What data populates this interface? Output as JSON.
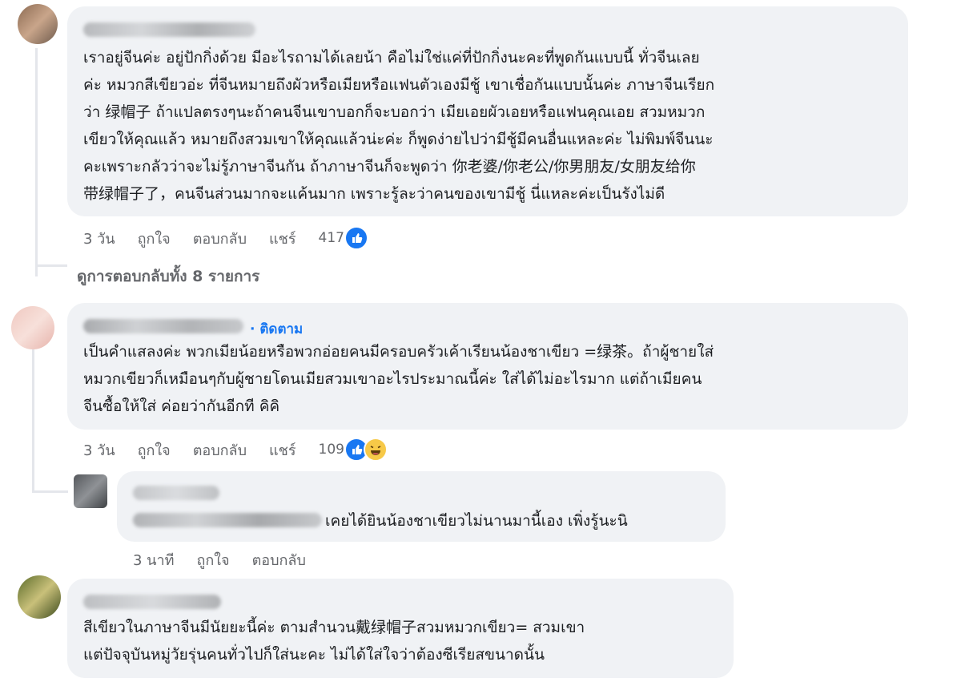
{
  "comments": [
    {
      "text": "เราอยู่จีนค่ะ อยู่ปักกิ่งด้วย มีอะไรถามได้เลยน้า คือไม่ใช่แค่ที่ปักกิ่งนะคะที่พูดกันแบบนี้ ทั่วจีนเลย\nค่ะ หมวกสีเขียวอ่ะ ที่จีนหมายถึงผัวหรือเมียหรือแฟนตัวเองมีชู้ เขาเชื่อกันแบบนั้นค่ะ ภาษาจีนเรียก\nว่า 绿帽子 ถ้าแปลตรงๆนะถ้าคนจีนเขาบอกก็จะบอกว่า เมียเอยผัวเอยหรือแฟนคุณเอย สวมหมวก\nเขียวให้คุณแล้ว หมายถึงสวมเขาให้คุณแล้วน่ะค่ะ ก็พูดง่ายไปว่ามีชู้มีคนอื่นแหละค่ะ ไม่พิมพ์จีนนะ\nคะเพราะกลัวว่าจะไม่รู้ภาษาจีนกัน ถ้าภาษาจีนก็จะพูดว่า 你老婆/你老公/你男朋友/女朋友给你\n带绿帽子了，คนจีนส่วนมากจะแค้นมาก เพราะรู้ละว่าคนของเขามีชู้ นี่แหละค่ะเป็นรังไม่ดี",
      "time": "3 วัน",
      "like": "ถูกใจ",
      "reply": "ตอบกลับ",
      "share": "แชร์",
      "reactions": "417",
      "view_replies": "ดูการตอบกลับทั้ง 8 รายการ"
    },
    {
      "follow": "· ติดตาม",
      "text": "เป็นคำแสลงค่ะ พวกเมียน้อยหรือพวกอ่อยคนมีครอบครัวเค้าเรียนน้องชาเขียว =绿茶。ถ้าผู้ชายใส่\nหมวกเขียวก็เหมือนๆกับผู้ชายโดนเมียสวมเขาอะไรประมาณนี้ค่ะ ใส่ได้ไม่อะไรมาก แต่ถ้าเมียคน\nจีนซื้อให้ใส่ ค่อยว่ากันอีกที คิคิ",
      "time": "3 วัน",
      "like": "ถูกใจ",
      "reply": "ตอบกลับ",
      "share": "แชร์",
      "reactions": "109"
    },
    {
      "text": "เคยได้ยินน้องชาเขียวไม่นานมานี้เอง เพิ่งรู้นะนิ",
      "time": "3 นาที",
      "like": "ถูกใจ",
      "reply": "ตอบกลับ"
    },
    {
      "text": "สีเขียวในภาษาจีนมีนัยยะนี้ค่ะ ตามสำนวน戴绿帽子สวมหมวกเขียว= สวมเขา\nแต่ปัจจุบันหมู่วัยรุ่นคนทั่วไปก็ใส่นะคะ ไม่ได้ใส่ใจว่าต้องซีเรียสขนาดนั้น"
    }
  ],
  "icons": {
    "like_reaction": "like-icon",
    "haha_reaction": "haha-icon"
  },
  "colors": {
    "bubble": "#f0f2f5",
    "link": "#1877f2",
    "meta": "#65676b"
  }
}
